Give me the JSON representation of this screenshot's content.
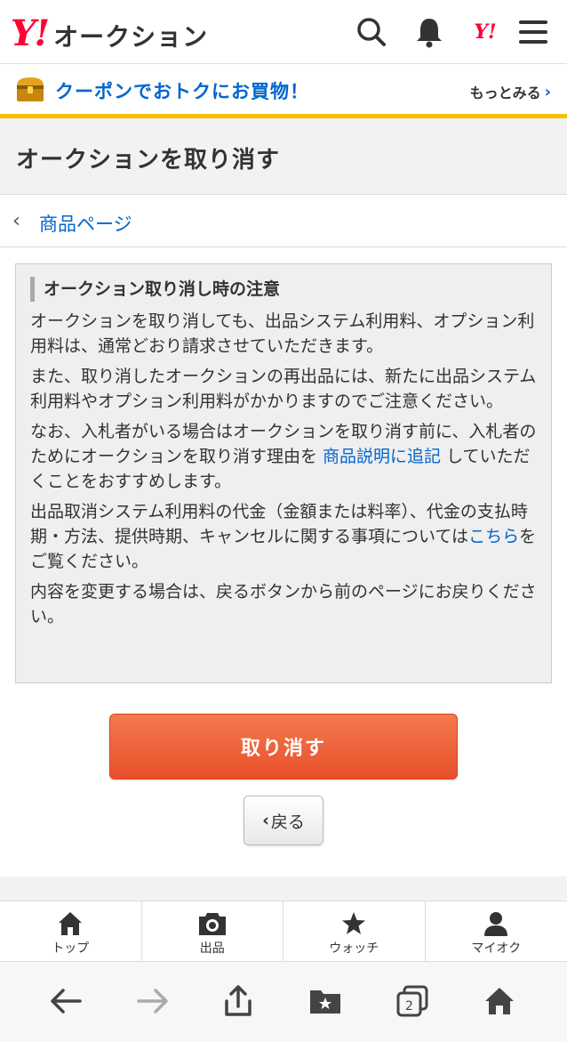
{
  "header": {
    "logo_y": "Y!",
    "logo_text": "オークション",
    "yahoo_mini": "Y!"
  },
  "coupon": {
    "text": "クーポンでおトクにお買物！",
    "more": "もっとみる",
    "chevron": "›"
  },
  "page": {
    "title": "オークションを取り消す"
  },
  "breadcrumb": {
    "chevron": "‹",
    "label": "商品ページ"
  },
  "notice": {
    "heading": "オークション取り消し時の注意",
    "p1": "オークションを取り消しても、出品システム利用料、オプション利用料は、通常どおり請求させていただきます。",
    "p2": "また、取り消したオークションの再出品には、新たに出品システム利用料やオプション利用料がかかりますのでご注意ください。",
    "p3_before": "なお、入札者がいる場合はオークションを取り消す前に、入札者のためにオークションを取り消す理由を ",
    "p3_link": "商品説明に追記",
    "p3_after": " していただくことをおすすめします。",
    "p4_before": "出品取消システム利用料の代金（金額または料率）、代金の支払時期・方法、提供時期、キャンセルに関する事項については",
    "p4_link": "こちら",
    "p4_after": "をご覧ください。",
    "p5": "内容を変更する場合は、戻るボタンから前のページにお戻りください。"
  },
  "actions": {
    "cancel_label": "取り消す",
    "back_chevron": "‹",
    "back_label": "戻る"
  },
  "tabbar": {
    "items": [
      {
        "label": "トップ",
        "icon": "home-icon"
      },
      {
        "label": "出品",
        "icon": "camera-icon"
      },
      {
        "label": "ウォッチ",
        "icon": "star-icon"
      },
      {
        "label": "マイオク",
        "icon": "person-icon"
      }
    ]
  },
  "browser": {
    "tab_count": "2"
  },
  "colors": {
    "brand_red": "#ff0033",
    "link_blue": "#0066cc",
    "coupon_yellow": "#f5c200",
    "cancel_orange": "#e84f2a"
  }
}
